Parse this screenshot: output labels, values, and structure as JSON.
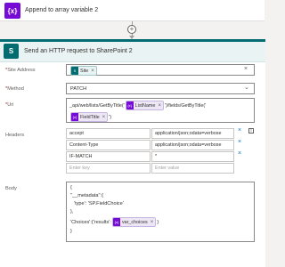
{
  "top_action": {
    "title": "Append to array variable 2",
    "icon_text": "{x}"
  },
  "add_step": {
    "symbol": "+"
  },
  "sp_action": {
    "title": "Send an HTTP request to SharePoint 2",
    "icon_text": "S"
  },
  "fields": {
    "site_address": {
      "label": "Site Address",
      "required": "*",
      "token": "Site"
    },
    "method": {
      "label": "Method",
      "required": "*",
      "value": "PATCH"
    },
    "uri": {
      "label": "Uri",
      "required": "*",
      "line1_prefix": "_api/web/lists/GetByTitle('",
      "token1": "ListName",
      "line1_suffix": "')/fields/GetByTitle('",
      "token2": "FieldTitle",
      "line2_suffix": "')"
    },
    "headers": {
      "label": "Headers",
      "rows": [
        {
          "key": "accept",
          "value": "application/json;odata=verbose"
        },
        {
          "key": "Content-Type",
          "value": "application/json;odata=verbose"
        },
        {
          "key": "IF-MATCH",
          "value": "*"
        }
      ],
      "key_placeholder": "Enter key",
      "value_placeholder": "Enter value"
    },
    "body": {
      "label": "Body",
      "line1": "{",
      "line2": "\"__metadata\":{",
      "line3": "'type': 'SP.FieldChoice'",
      "line4": "},",
      "line5_prefix": "'Choices':{'results':",
      "token": "var_choices",
      "line5_suffix": "}",
      "line6": "}"
    }
  },
  "colors": {
    "variable": "#770bd6",
    "sharepoint": "#036c70",
    "accent": "#0078d4"
  }
}
